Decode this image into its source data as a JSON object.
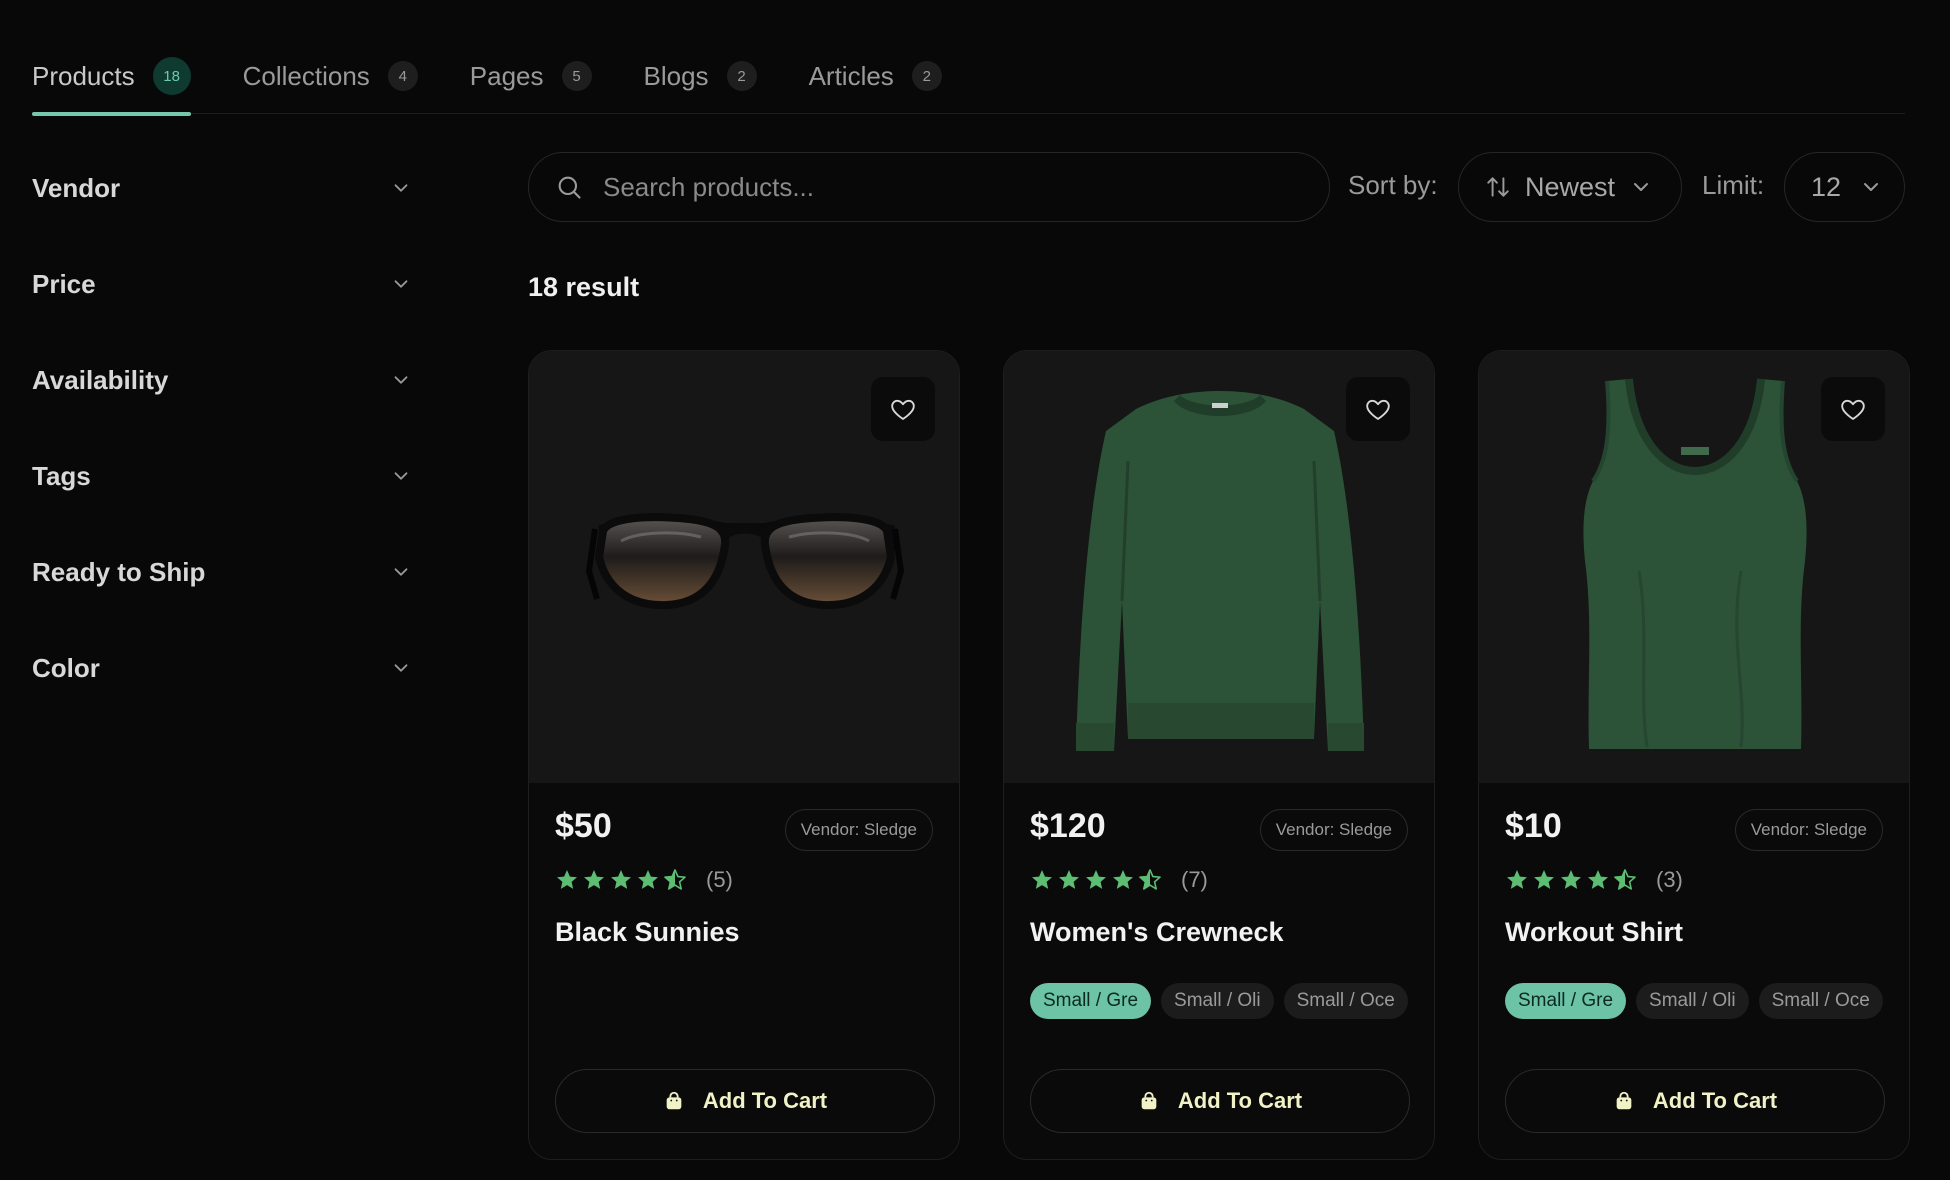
{
  "tabs": [
    {
      "label": "Products",
      "count": "18",
      "active": true
    },
    {
      "label": "Collections",
      "count": "4"
    },
    {
      "label": "Pages",
      "count": "5"
    },
    {
      "label": "Blogs",
      "count": "2"
    },
    {
      "label": "Articles",
      "count": "2"
    }
  ],
  "filters": [
    "Vendor",
    "Price",
    "Availability",
    "Tags",
    "Ready to Ship",
    "Color"
  ],
  "search": {
    "placeholder": "Search products...",
    "value": ""
  },
  "sort": {
    "label": "Sort by:",
    "value": "Newest"
  },
  "limit": {
    "label": "Limit:",
    "value": "12"
  },
  "results": {
    "text": "18 result"
  },
  "products": [
    {
      "name": "Black Sunnies",
      "price": "$50",
      "vendor": "Vendor: Sledge",
      "rating": 4.5,
      "reviews": "(5)",
      "variants": [],
      "cart_label": "Add To Cart",
      "icon": "sunglasses"
    },
    {
      "name": "Women's Crewneck",
      "price": "$120",
      "vendor": "Vendor: Sledge",
      "rating": 4.5,
      "reviews": "(7)",
      "variants": [
        "Small / Gre",
        "Small / Oli",
        "Small / Oce"
      ],
      "cart_label": "Add To Cart",
      "icon": "sweater"
    },
    {
      "name": "Workout Shirt",
      "price": "$10",
      "vendor": "Vendor: Sledge",
      "rating": 4.5,
      "reviews": "(3)",
      "variants": [
        "Small / Gre",
        "Small / Oli",
        "Small / Oce"
      ],
      "cart_label": "Add To Cart",
      "icon": "tank-top"
    }
  ],
  "colors": {
    "accent": "#76c7ab",
    "star": "#5cbd73",
    "background": "#080808",
    "product_green": "#2c5237"
  }
}
